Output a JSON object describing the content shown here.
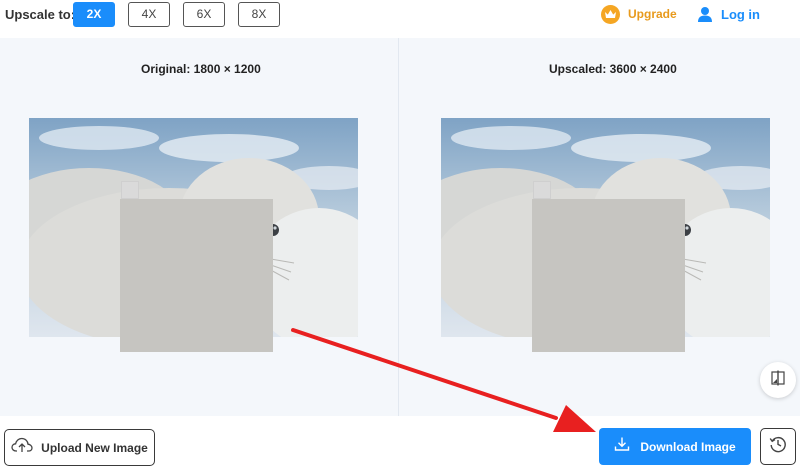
{
  "toolbar": {
    "upscale_label": "Upscale to:",
    "scale_options": [
      {
        "label": "2X",
        "selected": true
      },
      {
        "label": "4X",
        "selected": false
      },
      {
        "label": "6X",
        "selected": false
      },
      {
        "label": "8X",
        "selected": false
      }
    ],
    "upgrade_label": "Upgrade",
    "upgrade_icon": "crown-icon",
    "login_label": "Log in",
    "login_icon": "user-icon"
  },
  "preview": {
    "original_label": "Original: 1800 × 1200",
    "upscaled_label": "Upscaled: 3600 × 2400",
    "compare_icon": "compare-icon"
  },
  "bottom": {
    "upload_label": "Upload New Image",
    "upload_icon": "cloud-upload-icon",
    "download_label": "Download Image",
    "download_icon": "download-icon",
    "history_icon": "history-icon"
  },
  "colors": {
    "accent": "#1a8dfb",
    "upgrade": "#e89a1c",
    "annotation": "#e82020",
    "preview_background": "#f4f7fb"
  }
}
